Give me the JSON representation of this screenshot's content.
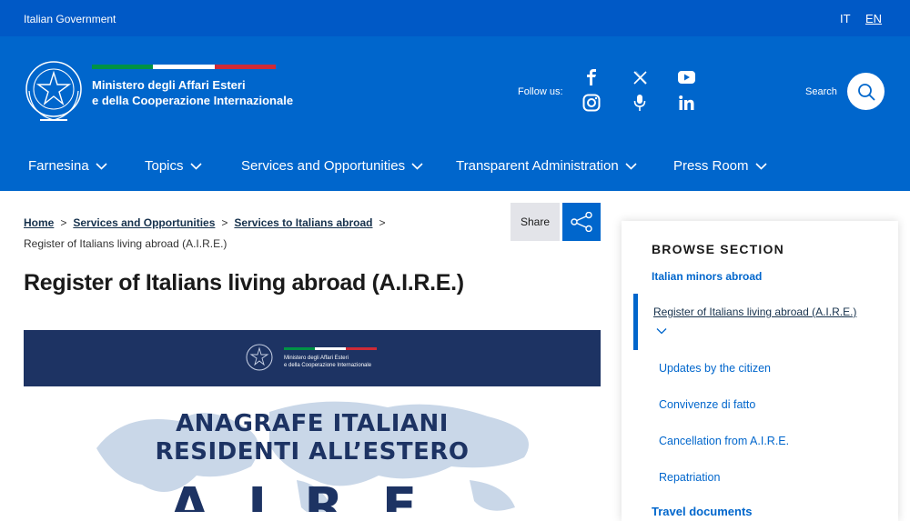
{
  "topbar": {
    "gov_label": "Italian Government",
    "lang_it": "IT",
    "lang_en": "EN"
  },
  "header": {
    "ministry_line1": "Ministero degli Affari Esteri",
    "ministry_line2": "e della Cooperazione Internazionale",
    "follow_label": "Follow us:",
    "search_label": "Search",
    "social_icons": [
      "facebook-icon",
      "x-icon",
      "youtube-icon",
      "instagram-icon",
      "podcast-icon",
      "linkedin-icon"
    ],
    "flag_colors": [
      "#009246",
      "#ffffff",
      "#ce2b37"
    ]
  },
  "nav": {
    "items": [
      {
        "label": "Farnesina"
      },
      {
        "label": "Topics"
      },
      {
        "label": "Services and Opportunities"
      },
      {
        "label": "Transparent Administration"
      },
      {
        "label": "Press Room"
      }
    ]
  },
  "breadcrumb": {
    "home": "Home",
    "level1": "Services and Opportunities",
    "level2": "Services to Italians abroad",
    "current": "Register of Italians living abroad (A.I.R.E.)",
    "separator": ">"
  },
  "share": {
    "label": "Share"
  },
  "page": {
    "title": "Register of Italians living abroad (A.I.R.E.)"
  },
  "hero": {
    "ministry_line1": "Ministero degli Affari Esteri",
    "ministry_line2": "e della Cooperazione Internazionale",
    "heading_line1": "ANAGRAFE ITALIANI",
    "heading_line2": "RESIDENTI ALL’ESTERO",
    "heading_line3": "A.I.R.E."
  },
  "sidebar": {
    "heading": "BROWSE SECTION",
    "prev_item": "Italian minors abroad",
    "active_item": "Register of Italians living abroad (A.I.R.E.)",
    "sub_items": [
      {
        "label": "Updates by the citizen"
      },
      {
        "label": "Convivenze di fatto"
      },
      {
        "label": "Cancellation from A.I.R.E."
      },
      {
        "label": "Repatriation"
      }
    ],
    "next_item": "Travel documents"
  },
  "colors": {
    "topbar": "#0059c6",
    "header": "#0066cc",
    "hero_band": "#1d3363"
  }
}
